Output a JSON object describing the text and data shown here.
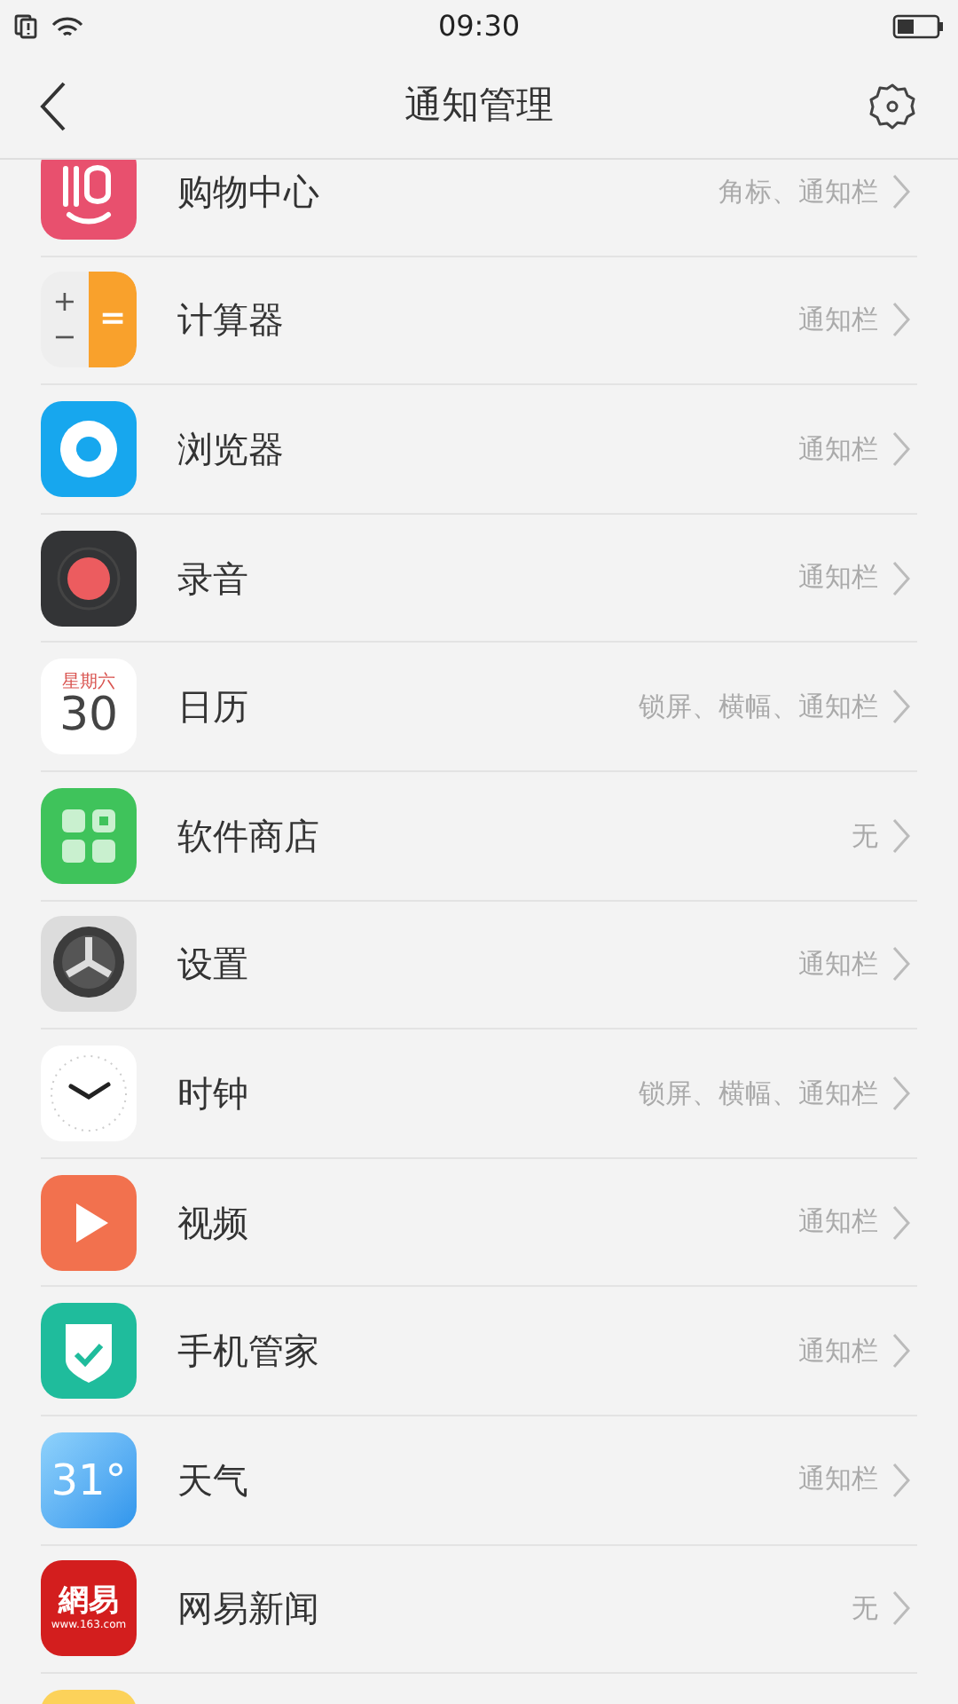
{
  "status_bar": {
    "time": "09:30"
  },
  "header": {
    "title": "通知管理"
  },
  "apps": [
    {
      "kind": "shopping",
      "name": "购物中心",
      "value": "角标、通知栏"
    },
    {
      "kind": "calculator",
      "name": "计算器",
      "value": "通知栏",
      "icon_text": [
        "+",
        "−",
        "="
      ]
    },
    {
      "kind": "browser",
      "name": "浏览器",
      "value": "通知栏"
    },
    {
      "kind": "recorder",
      "name": "录音",
      "value": "通知栏"
    },
    {
      "kind": "calendar",
      "name": "日历",
      "value": "锁屏、横幅、通知栏",
      "icon_text": [
        "星期六",
        "30"
      ]
    },
    {
      "kind": "store",
      "name": "软件商店",
      "value": "无"
    },
    {
      "kind": "settings",
      "name": "设置",
      "value": "通知栏"
    },
    {
      "kind": "clock",
      "name": "时钟",
      "value": "锁屏、横幅、通知栏"
    },
    {
      "kind": "video",
      "name": "视频",
      "value": "通知栏"
    },
    {
      "kind": "security",
      "name": "手机管家",
      "value": "通知栏"
    },
    {
      "kind": "weather",
      "name": "天气",
      "value": "通知栏",
      "icon_text": [
        "31°"
      ]
    },
    {
      "kind": "news",
      "name": "网易新闻",
      "value": "无",
      "icon_text": [
        "網易",
        "www.163.com"
      ]
    },
    {
      "kind": "notes"
    }
  ]
}
